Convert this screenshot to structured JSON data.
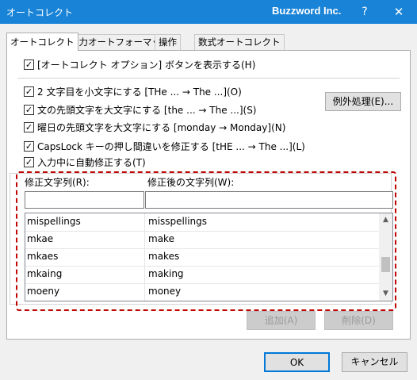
{
  "window": {
    "app_title": "オートコレクト",
    "doc_title": "Buzzword Inc.",
    "help_label": "?",
    "close_label": "✕"
  },
  "tabs": [
    {
      "label": "オートコレクト",
      "active": true
    },
    {
      "label": "入力オートフォーマット",
      "active": false
    },
    {
      "label": "操作",
      "active": false
    },
    {
      "label": "数式オートコレクト",
      "active": false
    }
  ],
  "options": {
    "show_buttons": {
      "label": "[オートコレクト オプション] ボタンを表示する(H)",
      "checked": true
    },
    "two_initial_caps": {
      "label": "2 文字目を小文字にする [THe ... → The ...](O)",
      "checked": true
    },
    "capitalize_first_sentence": {
      "label": "文の先頭文字を大文字にする [the ... → The ...](S)",
      "checked": true
    },
    "capitalize_days": {
      "label": "曜日の先頭文字を大文字にする [monday → Monday](N)",
      "checked": true
    },
    "caps_lock": {
      "label": "CapsLock キーの押し間違いを修正する [tHE ... → The ...](L)",
      "checked": true
    },
    "replace_text": {
      "label": "入力中に自動修正する(T)",
      "checked": true
    }
  },
  "exceptions_button": "例外処理(E)...",
  "replace": {
    "col_replace_label": "修正文字列(R):",
    "col_with_label": "修正後の文字列(W):",
    "replace_value": "",
    "with_value": ""
  },
  "entries": [
    {
      "replace": "mispellings",
      "with": "misspellings"
    },
    {
      "replace": "mkae",
      "with": "make"
    },
    {
      "replace": "mkaes",
      "with": "makes"
    },
    {
      "replace": "mkaing",
      "with": "making"
    },
    {
      "replace": "moeny",
      "with": "money"
    }
  ],
  "add_button": "追加(A)",
  "delete_button": "削除(D)",
  "ok_button": "OK",
  "cancel_button": "キャンセル",
  "checkmark": "✓",
  "scroll_up": "▲",
  "scroll_down": "▼",
  "colors": {
    "titlebar": "#1883d7",
    "highlight_border": "#c00000"
  }
}
